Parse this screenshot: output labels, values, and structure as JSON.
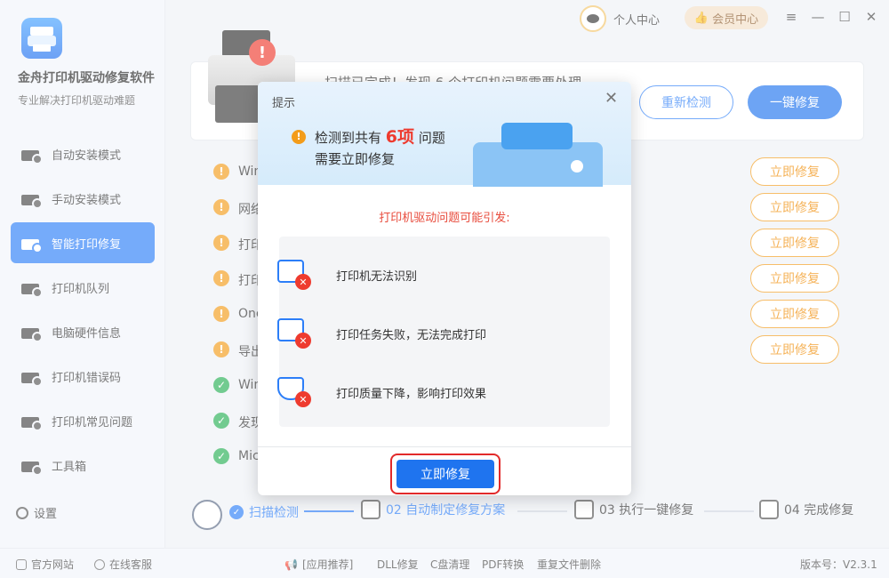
{
  "app": {
    "title": "金舟打印机驱动修复软件",
    "subtitle": "专业解决打印机驱动难题"
  },
  "sidebar": {
    "items": [
      {
        "label": "自动安装模式",
        "active": false
      },
      {
        "label": "手动安装模式",
        "active": false
      },
      {
        "label": "智能打印修复",
        "active": true
      },
      {
        "label": "打印机队列",
        "active": false
      },
      {
        "label": "电脑硬件信息",
        "active": false
      },
      {
        "label": "打印机错误码",
        "active": false
      },
      {
        "label": "打印机常见问题",
        "active": false
      },
      {
        "label": "工具箱",
        "active": false
      }
    ],
    "settings_label": "设置"
  },
  "topbar": {
    "user_label": "个人中心",
    "vip_label": "会员中心",
    "minimize": "—",
    "restore": "☐",
    "close": "✕",
    "pin": "≡"
  },
  "main": {
    "scan_summary": "扫描已完成！发现 6 个打印机问题需要处理",
    "rescan_label": "重新检测",
    "onekey_fix_label": "一键修复",
    "issues": [
      {
        "text": "Win",
        "status": "warn",
        "fix_label": "立即修复"
      },
      {
        "text": "网络",
        "status": "warn",
        "fix_label": "立即修复"
      },
      {
        "text": "打印",
        "status": "warn",
        "fix_label": "立即修复"
      },
      {
        "text": "打印",
        "status": "warn",
        "fix_label": "立即修复"
      },
      {
        "text": "One",
        "status": "warn",
        "fix_label": "立即修复"
      },
      {
        "text": "导出",
        "status": "warn",
        "fix_label": "立即修复"
      },
      {
        "text": "Win",
        "status": "ok",
        "fix_label": ""
      },
      {
        "text": "发现",
        "status": "ok",
        "fix_label": ""
      },
      {
        "text": "Mic",
        "status": "ok",
        "fix_label": ""
      }
    ]
  },
  "steps": [
    {
      "label": "扫描检测",
      "state": "done"
    },
    {
      "label": "02 自动制定修复方案",
      "state": "current"
    },
    {
      "label": "03 执行一键修复",
      "state": "pending"
    },
    {
      "label": "04 完成修复",
      "state": "pending"
    }
  ],
  "footer": {
    "official_site": "官方网站",
    "online_service": "在线客服",
    "recommend": "[应用推荐]",
    "links": [
      "DLL修复",
      "C盘清理",
      "PDF转换",
      "重复文件删除"
    ],
    "version": "版本号：V2.3.1"
  },
  "modal": {
    "title": "提示",
    "close": "✕",
    "detect_prefix": "检测到共有",
    "detect_count": "6项",
    "detect_suffix": "问题",
    "detect_line2": "需要立即修复",
    "cause_title": "打印机驱动问题可能引发:",
    "causes": [
      "打印机无法识别",
      "打印任务失败，无法完成打印",
      "打印质量下降，影响打印效果"
    ],
    "fix_now_label": "立即修复"
  },
  "colors": {
    "accent": "#1f74ef",
    "warning": "#f39c1a",
    "danger": "#ee3b2f",
    "success": "#27b055"
  }
}
